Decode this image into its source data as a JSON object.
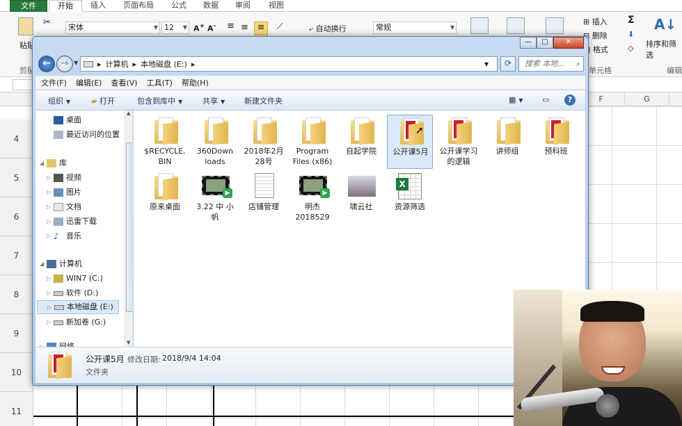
{
  "excel": {
    "tabs": [
      "文件",
      "开始",
      "插入",
      "页面布局",
      "公式",
      "数据",
      "审阅",
      "视图"
    ],
    "ribbon": {
      "paste_label": "粘贴",
      "clipboard_group": "剪贴",
      "font_name": "宋体",
      "font_size": "12",
      "wrap_text": "自动换行",
      "number_format": "常规",
      "insert": "插入",
      "delete": "删除",
      "format": "格式",
      "sort_filter": "排序和筛选",
      "cells_group": "单元格",
      "edit_group": "编辑",
      "sigma": "Σ"
    },
    "columns": [
      "F",
      "G"
    ],
    "rows": [
      "4",
      "5",
      "6",
      "7",
      "8",
      "9",
      "10",
      "11"
    ]
  },
  "explorer": {
    "window_controls": {
      "minimize": "—",
      "maximize": "□",
      "close": "✕"
    },
    "breadcrumb": [
      "计算机",
      "本地磁盘 (E:)"
    ],
    "search_placeholder": "搜索 本地...",
    "menu": [
      "文件(F)",
      "编辑(E)",
      "查看(V)",
      "工具(T)",
      "帮助(H)"
    ],
    "toolbar": {
      "organize": "组织",
      "open": "打开",
      "include_library": "包含到库中",
      "share": "共享",
      "new_folder": "新建文件夹"
    },
    "nav": [
      {
        "label": "桌面",
        "icon": "desktop-icon",
        "level": 1
      },
      {
        "label": "最近访问的位置",
        "icon": "recent-places-icon",
        "level": 1
      },
      {
        "label": "库",
        "icon": "library-icon",
        "level": 0
      },
      {
        "label": "视频",
        "icon": "video-library-icon",
        "level": 1
      },
      {
        "label": "图片",
        "icon": "pictures-library-icon",
        "level": 1
      },
      {
        "label": "文档",
        "icon": "documents-library-icon",
        "level": 1
      },
      {
        "label": "迅雷下载",
        "icon": "download-folder-icon",
        "level": 1
      },
      {
        "label": "音乐",
        "icon": "music-library-icon",
        "level": 1
      },
      {
        "label": "计算机",
        "icon": "computer-icon",
        "level": 0
      },
      {
        "label": "WIN7 (C:)",
        "icon": "system-drive-icon",
        "level": 1
      },
      {
        "label": "软件 (D:)",
        "icon": "drive-icon",
        "level": 1
      },
      {
        "label": "本地磁盘 (E:)",
        "icon": "drive-icon",
        "level": 1,
        "selected": true
      },
      {
        "label": "新加卷 (G:)",
        "icon": "drive-icon",
        "level": 1
      },
      {
        "label": "网络",
        "icon": "network-icon",
        "level": 0
      }
    ],
    "files": [
      {
        "name": "$RECYCLE.\nBIN",
        "type": "folder"
      },
      {
        "name": "360Down\nloads",
        "type": "folder"
      },
      {
        "name": "2018年2月\n28号",
        "type": "folder"
      },
      {
        "name": "Program\nFiles (x86)",
        "type": "folder"
      },
      {
        "name": "自起学院",
        "type": "folder"
      },
      {
        "name": "公开课5月",
        "type": "folder-red",
        "selected": true
      },
      {
        "name": "公开课学习\n的逻辑",
        "type": "folder-red"
      },
      {
        "name": "讲师组",
        "type": "folder"
      },
      {
        "name": "预科班",
        "type": "folder-red"
      },
      {
        "name": "原来桌面",
        "type": "folder"
      },
      {
        "name": "3.22 中 小\n帆",
        "type": "video"
      },
      {
        "name": "店铺管理",
        "type": "document"
      },
      {
        "name": "明杰\n2018529",
        "type": "video"
      },
      {
        "name": "啸云社",
        "type": "photo"
      },
      {
        "name": "资源筛选",
        "type": "excel"
      }
    ],
    "details": {
      "name": "公开课5月",
      "modified_label": "修改日期:",
      "modified_value": "2018/9/4 14:04",
      "type": "文件夹"
    }
  }
}
